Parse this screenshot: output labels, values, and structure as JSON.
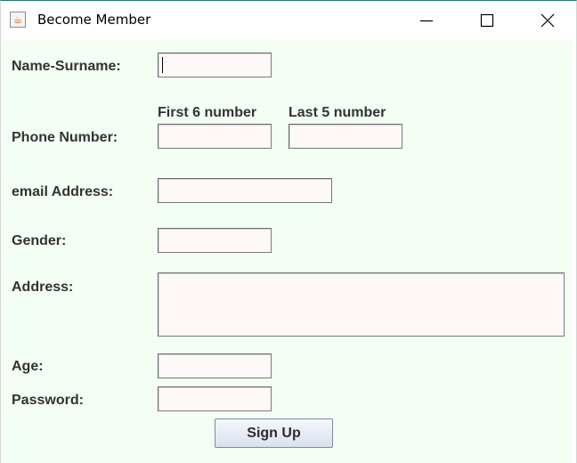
{
  "window": {
    "title": "Become Member",
    "icon": "java-cup-icon"
  },
  "form": {
    "name_label": "Name-Surname:",
    "phone_label": "Phone Number:",
    "phone_first_caption": "First 6 number",
    "phone_last_caption": "Last 5 number",
    "email_label": "email Address:",
    "gender_label": "Gender:",
    "address_label": "Address:",
    "age_label": "Age:",
    "password_label": "Password:",
    "values": {
      "name": "",
      "phone_first": "",
      "phone_last": "",
      "email": "",
      "gender": "",
      "address": "",
      "age": "",
      "password": ""
    },
    "signup_label": "Sign Up"
  },
  "colors": {
    "form_background": "#f2fff2",
    "field_background": "#fff8f8",
    "label_text": "#333333"
  }
}
